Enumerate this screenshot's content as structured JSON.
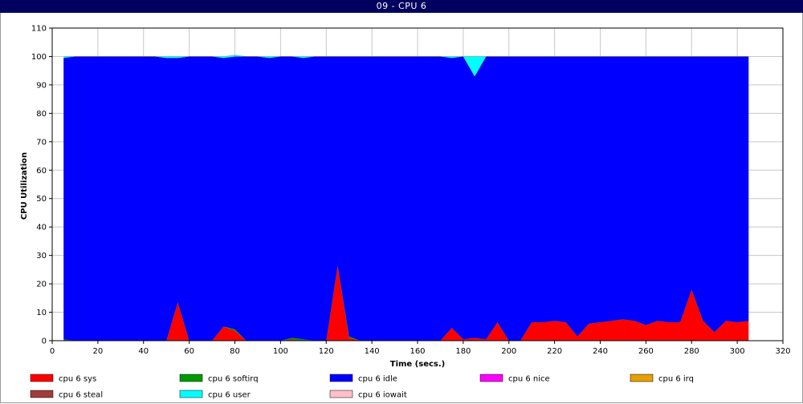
{
  "window": {
    "title": "09 - CPU 6"
  },
  "chart_data": {
    "type": "area",
    "stacked": true,
    "title": "",
    "xlabel": "Time (secs.)",
    "ylabel": "CPU Utilization",
    "xlim": [
      0,
      320
    ],
    "ylim": [
      0,
      110
    ],
    "xticks": [
      0,
      20,
      40,
      60,
      80,
      100,
      120,
      140,
      160,
      180,
      200,
      220,
      240,
      260,
      280,
      300,
      320
    ],
    "yticks": [
      0,
      10,
      20,
      30,
      40,
      50,
      60,
      70,
      80,
      90,
      100,
      110
    ],
    "grid": true,
    "legend_position": "bottom",
    "x": [
      5,
      10,
      15,
      20,
      25,
      30,
      35,
      40,
      45,
      50,
      55,
      60,
      65,
      70,
      75,
      80,
      85,
      90,
      95,
      100,
      105,
      110,
      115,
      120,
      125,
      130,
      135,
      140,
      145,
      150,
      155,
      160,
      165,
      170,
      175,
      180,
      185,
      190,
      195,
      200,
      205,
      210,
      215,
      220,
      225,
      230,
      235,
      240,
      245,
      250,
      255,
      260,
      265,
      270,
      275,
      280,
      285,
      290,
      295,
      300,
      305
    ],
    "series": [
      {
        "name": "cpu 6 sys",
        "color": "#ff0000",
        "values": [
          0,
          0,
          0,
          0,
          0,
          0,
          0,
          0,
          0,
          0,
          13.5,
          0,
          0,
          0,
          5,
          3.5,
          0,
          0,
          0,
          0,
          0.5,
          0,
          0,
          0,
          26.5,
          1,
          0,
          0,
          0,
          0,
          0,
          0,
          0,
          0,
          4.5,
          0.5,
          1,
          0.5,
          6.5,
          0,
          0,
          6.5,
          6.5,
          7,
          6.5,
          1.5,
          6,
          6.5,
          7,
          7.5,
          7,
          5.5,
          7,
          6.5,
          6.5,
          18,
          7,
          3,
          7,
          6.5,
          7
        ]
      },
      {
        "name": "cpu 6 softirq",
        "color": "#009a00",
        "values": [
          0.5,
          0,
          0,
          0,
          0,
          0,
          0,
          0,
          0,
          0,
          0,
          0,
          0,
          0,
          0,
          0.5,
          0,
          0,
          0,
          0,
          0.5,
          0.5,
          0,
          0,
          0,
          0.5,
          0,
          0,
          0,
          0,
          0,
          0,
          0,
          0,
          0,
          0,
          0,
          0,
          0,
          0,
          0,
          0,
          0,
          0,
          0,
          0,
          0,
          0,
          0,
          0,
          0,
          0,
          0,
          0,
          0,
          0,
          0,
          0,
          0,
          0,
          0
        ]
      },
      {
        "name": "cpu 6 idle",
        "color": "#0000ff",
        "values": [
          99,
          100,
          100,
          100,
          100,
          100,
          100,
          100,
          100,
          99.5,
          86,
          100,
          100,
          100,
          94.5,
          96,
          100,
          100,
          99.5,
          100,
          99,
          99,
          100,
          100,
          73.5,
          98.5,
          100,
          100,
          100,
          100,
          100,
          100,
          100,
          100,
          95,
          99.5,
          92,
          99.5,
          93.5,
          100,
          100,
          93.5,
          93.5,
          93,
          93.5,
          98.5,
          94,
          93.5,
          93,
          92.5,
          93,
          94.5,
          93,
          93.5,
          93.5,
          82,
          93,
          97,
          93,
          93.5,
          93
        ]
      },
      {
        "name": "cpu 6 nice",
        "color": "#ff00ff",
        "values": [
          0,
          0,
          0,
          0,
          0,
          0,
          0,
          0,
          0,
          0,
          0,
          0,
          0,
          0,
          0,
          0,
          0,
          0,
          0,
          0,
          0,
          0,
          0,
          0,
          0,
          0,
          0,
          0,
          0,
          0,
          0,
          0,
          0,
          0,
          0,
          0,
          0,
          0,
          0,
          0,
          0,
          0,
          0,
          0,
          0,
          0,
          0,
          0,
          0,
          0,
          0,
          0,
          0,
          0,
          0,
          0,
          0,
          0,
          0,
          0,
          0
        ]
      },
      {
        "name": "cpu 6 irq",
        "color": "#e6a000",
        "values": [
          0,
          0,
          0,
          0,
          0,
          0,
          0,
          0,
          0,
          0,
          0,
          0,
          0,
          0,
          0,
          0,
          0,
          0,
          0,
          0,
          0,
          0,
          0,
          0,
          0,
          0,
          0,
          0,
          0,
          0,
          0,
          0,
          0,
          0,
          0,
          0,
          0,
          0,
          0,
          0,
          0,
          0,
          0,
          0,
          0,
          0,
          0,
          0,
          0,
          0,
          0,
          0,
          0,
          0,
          0,
          0,
          0,
          0,
          0,
          0,
          0
        ]
      },
      {
        "name": "cpu 6 steal",
        "color": "#a03c3c",
        "values": [
          0,
          0,
          0,
          0,
          0,
          0,
          0,
          0,
          0,
          0,
          0,
          0,
          0,
          0,
          0,
          0,
          0,
          0,
          0,
          0,
          0,
          0,
          0,
          0,
          0,
          0,
          0,
          0,
          0,
          0,
          0,
          0,
          0,
          0,
          0,
          0,
          0,
          0,
          0,
          0,
          0,
          0,
          0,
          0,
          0,
          0,
          0,
          0,
          0,
          0,
          0,
          0,
          0,
          0,
          0,
          0,
          0,
          0,
          0,
          0,
          0
        ]
      },
      {
        "name": "cpu 6 user",
        "color": "#00ffff",
        "values": [
          0.5,
          0,
          0,
          0,
          0,
          0,
          0,
          0,
          0,
          0.5,
          0.5,
          0,
          0,
          0,
          0.5,
          0.5,
          0,
          0,
          0.5,
          0,
          0,
          0.5,
          0,
          0,
          0,
          0,
          0,
          0,
          0,
          0,
          0,
          0,
          0,
          0,
          0.5,
          0,
          7,
          0,
          0,
          0,
          0,
          0,
          0,
          0,
          0,
          0,
          0,
          0,
          0,
          0,
          0,
          0,
          0,
          0,
          0,
          0,
          0,
          0,
          0,
          0,
          0
        ]
      },
      {
        "name": "cpu 6 iowait",
        "color": "#ffc0cb",
        "values": [
          0,
          0,
          0,
          0,
          0,
          0,
          0,
          0,
          0,
          0,
          0,
          0,
          0,
          0,
          0,
          0,
          0,
          0,
          0,
          0,
          0,
          0,
          0,
          0,
          0,
          0,
          0,
          0,
          0,
          0,
          0,
          0,
          0,
          0,
          0,
          0,
          0,
          0,
          0,
          0,
          0,
          0,
          0,
          0,
          0,
          0,
          0,
          0,
          0,
          0,
          0,
          0,
          0,
          0,
          0,
          0,
          0,
          0,
          0,
          0,
          0
        ]
      }
    ]
  }
}
